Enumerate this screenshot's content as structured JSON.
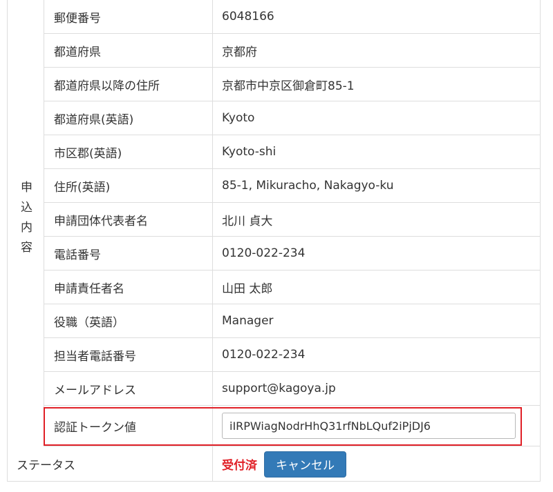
{
  "section": {
    "group_label": "申込内容",
    "rows": [
      {
        "label": "郵便番号",
        "value": "6048166"
      },
      {
        "label": "都道府県",
        "value": "京都府"
      },
      {
        "label": "都道府県以降の住所",
        "value": "京都市中京区御倉町85-1"
      },
      {
        "label": "都道府県(英語)",
        "value": "Kyoto"
      },
      {
        "label": "市区郡(英語)",
        "value": "Kyoto-shi"
      },
      {
        "label": "住所(英語)",
        "value": "85-1, Mikuracho, Nakagyo-ku"
      },
      {
        "label": "申請団体代表者名",
        "value": "北川 貞大"
      },
      {
        "label": "電話番号",
        "value": "0120-022-234"
      },
      {
        "label": "申請責任者名",
        "value": "山田 太郎"
      },
      {
        "label": "役職（英語）",
        "value": "Manager"
      },
      {
        "label": "担当者電話番号",
        "value": "0120-022-234"
      },
      {
        "label": "メールアドレス",
        "value": "support@kagoya.jp"
      }
    ],
    "token": {
      "label": "認証トークン値",
      "value": "iIRPWiagNodrHhQ31rfNbLQuf2iPjDJ6"
    }
  },
  "status": {
    "label": "ステータス",
    "value": "受付済",
    "cancel_label": "キャンセル"
  },
  "colors": {
    "highlight": "#e01f26",
    "status": "#e01f26",
    "button": "#337ab7"
  }
}
